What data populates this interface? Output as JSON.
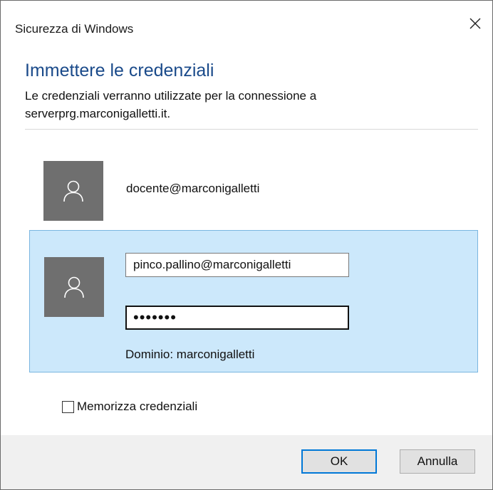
{
  "window": {
    "title": "Sicurezza di Windows",
    "close_icon": "close-icon"
  },
  "header": {
    "heading": "Immettere le credenziali",
    "subtitle": "Le credenziali verranno utilizzate per la connessione a serverprg.marconigalletti.it."
  },
  "accounts": [
    {
      "icon": "user-icon",
      "name": "docente@marconigalletti"
    }
  ],
  "selected_account": {
    "icon": "user-icon",
    "username_value": "pinco.pallino@marconigalletti",
    "password_value": "•••••••",
    "domain_text": "Dominio: marconigalletti"
  },
  "options": {
    "remember_label": "Memorizza credenziali",
    "remember_checked": false
  },
  "footer": {
    "ok_label": "OK",
    "cancel_label": "Annulla"
  },
  "colors": {
    "heading": "#1a4a8a",
    "selection_bg": "#cce8fb",
    "selection_border": "#7ab6e0",
    "avatar_bg": "#6f6f6f",
    "default_button_border": "#0078d7"
  }
}
